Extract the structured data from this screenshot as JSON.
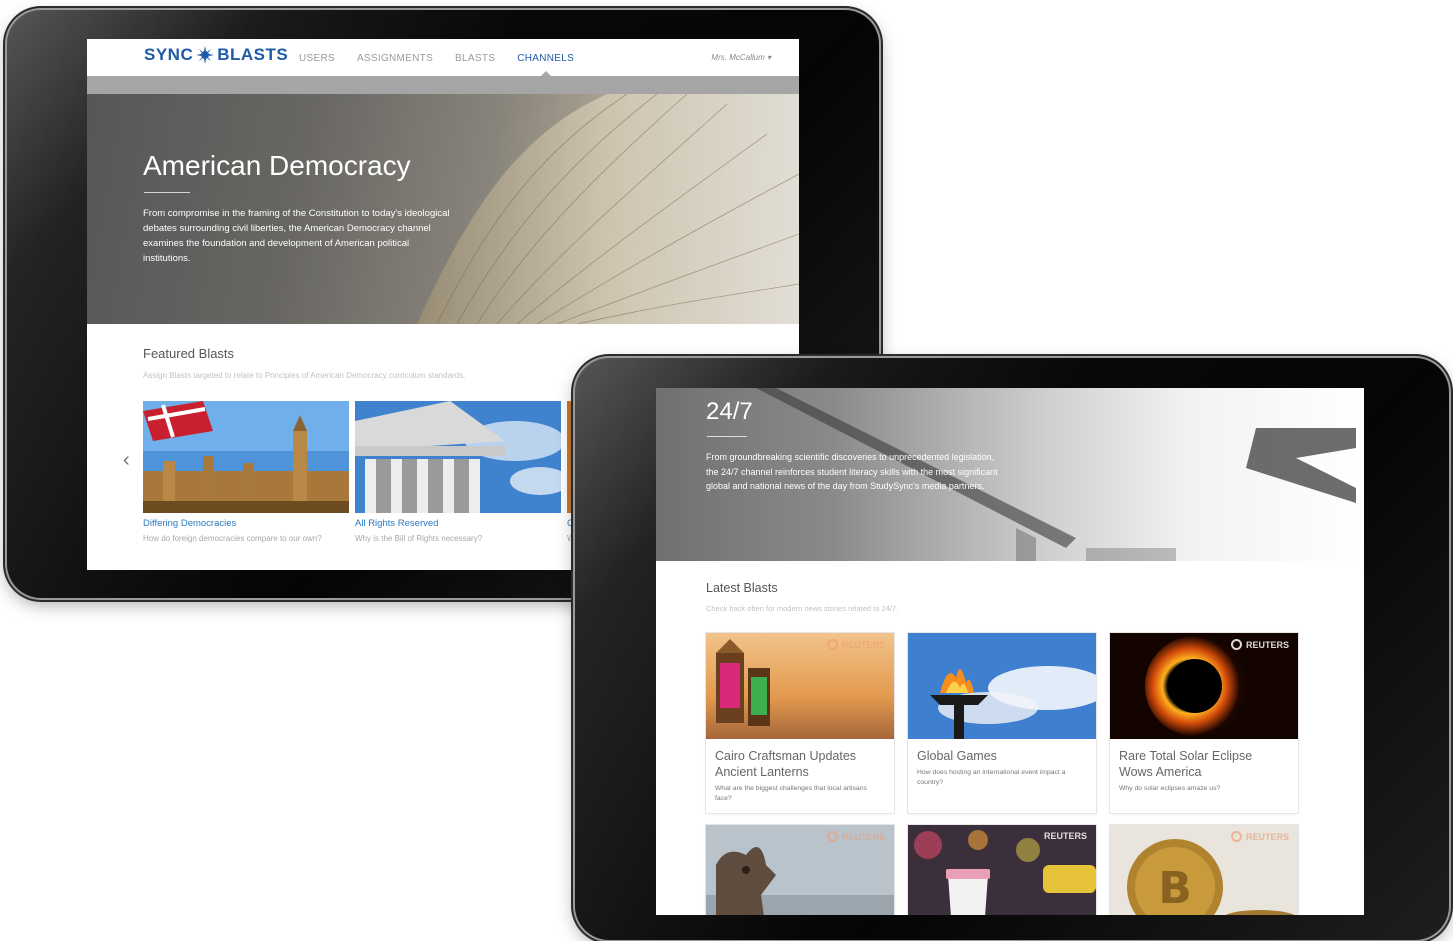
{
  "tablet_back": {
    "nav": {
      "brand_left": "SYNC",
      "brand_right": "BLASTS",
      "links": [
        "USERS",
        "ASSIGNMENTS",
        "BLASTS",
        "CHANNELS"
      ],
      "active_link": "CHANNELS",
      "user_menu": "Mrs. McCallum ▾"
    },
    "hero": {
      "title": "American Democracy",
      "description": "From compromise in the framing of the Constitution to today's ideological debates surrounding civil liberties, the American Democracy channel examines the foundation and development of American political institutions."
    },
    "featured": {
      "title": "Featured Blasts",
      "subtitle": "Assign Blasts targeted to relate to Principles of American Democracy curriculum standards.",
      "prev_glyph": "‹",
      "cards": [
        {
          "title": "Differing Democracies",
          "subtitle": "How do foreign democracies compare to our own?"
        },
        {
          "title": "All Rights Reserved",
          "subtitle": "Why is the Bill of Rights necessary?"
        },
        {
          "title": "C",
          "subtitle": "W"
        }
      ]
    }
  },
  "tablet_front": {
    "hero": {
      "title": "24/7",
      "description": "From groundbreaking scientific discoveries to unprecedented legislation, the 24/7 channel reinforces student literacy skills with the most significant global and national news of the day from StudySync's media partners."
    },
    "latest": {
      "title": "Latest Blasts",
      "subtitle": "Check back often for modern news stories related to 24/7.",
      "source_label": "REUTERS",
      "cards": [
        {
          "title": "Cairo Craftsman Updates Ancient Lanterns",
          "subtitle": "What are the biggest challenges that local artisans face?"
        },
        {
          "title": "Global Games",
          "subtitle": "How does hosting an international event impact a country?"
        },
        {
          "title": "Rare Total Solar Eclipse Wows America",
          "subtitle": "Why do solar eclipses amaze us?"
        },
        {
          "title": "",
          "subtitle": ""
        },
        {
          "title": "",
          "subtitle": ""
        },
        {
          "title": "",
          "subtitle": ""
        }
      ]
    }
  },
  "colors": {
    "brand_blue": "#1f5aa8",
    "link_blue": "#2a7bc0",
    "nav_gray": "#9a9a9a",
    "band_gray": "#a5a5a5"
  }
}
